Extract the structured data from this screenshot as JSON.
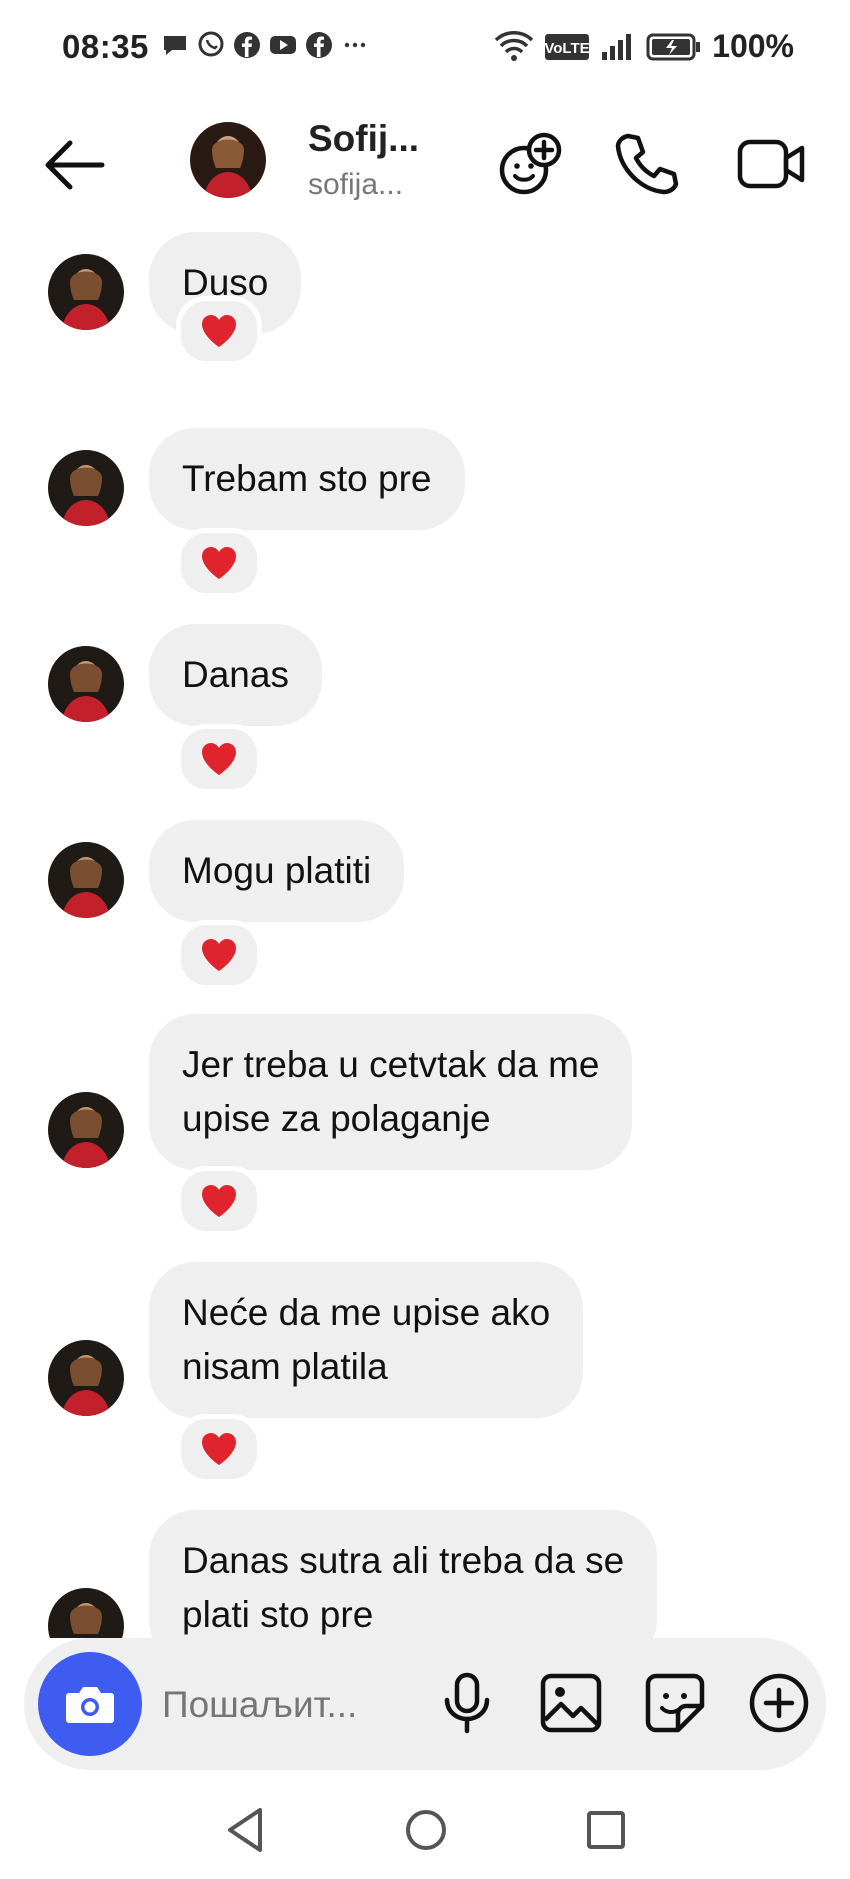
{
  "status_bar": {
    "time": "08:35",
    "notification_icons": [
      "message-icon",
      "viber-icon",
      "facebook-icon",
      "youtube-icon",
      "facebook-icon",
      "more-dots-icon"
    ],
    "network_badge": "VoLTE",
    "battery": "100%"
  },
  "header": {
    "contact_name": "Sofij...",
    "contact_handle": "sofija...",
    "actions": [
      "add-people-icon",
      "phone-icon",
      "video-camera-icon"
    ]
  },
  "messages": [
    {
      "text": "Duso",
      "reaction": "❤️"
    },
    {
      "text": "Trebam sto pre",
      "reaction": "❤️"
    },
    {
      "text": "Danas",
      "reaction": "❤️"
    },
    {
      "text": "Mogu platiti",
      "reaction": "❤️"
    },
    {
      "text": "Jer treba u cetvtak da me\nupise za polaganje",
      "reaction": "❤️"
    },
    {
      "text": "Neće da me upise ako\nnisam platila",
      "reaction": "❤️"
    },
    {
      "text": "Danas sutra ali treba da se\nplati sto pre",
      "reaction": ""
    }
  ],
  "composer": {
    "placeholder": "Пошаљит...",
    "buttons": [
      "camera-icon",
      "microphone-icon",
      "gallery-icon",
      "sticker-icon",
      "plus-icon"
    ]
  },
  "colors": {
    "bubble": "#efefef",
    "camera_button": "#3f5cf0",
    "heart": "#e0242e"
  },
  "nav": [
    "back-triangle-icon",
    "home-circle-icon",
    "recents-square-icon"
  ]
}
